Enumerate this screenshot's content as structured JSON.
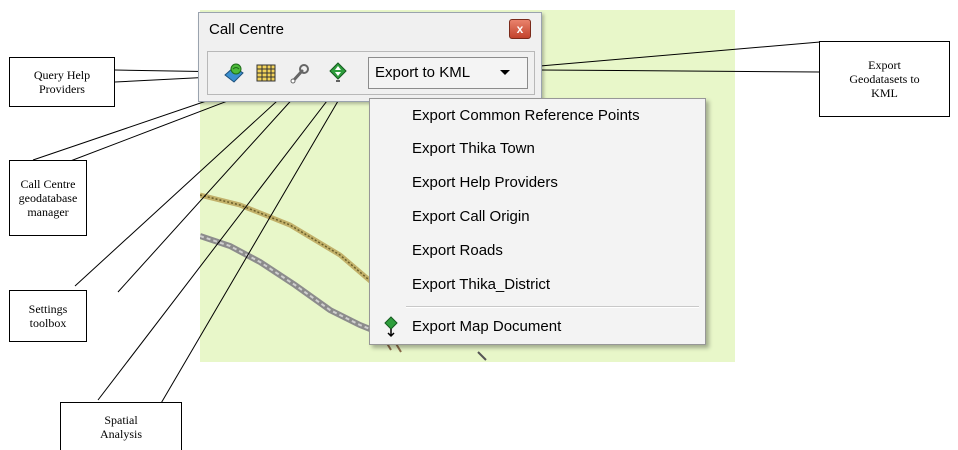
{
  "window": {
    "title": "Call Centre",
    "close_label": "x"
  },
  "toolbar": {
    "tools": [
      {
        "name": "query-help-providers-tool",
        "icon": "globe-query-icon"
      },
      {
        "name": "geodatabase-manager-tool",
        "icon": "grid-table-icon"
      },
      {
        "name": "settings-toolbox-tool",
        "icon": "wrench-icon"
      },
      {
        "name": "spatial-analysis-tool",
        "icon": "green-diamond-arrows-icon"
      }
    ],
    "export_label": "Export to KML"
  },
  "menu": {
    "items": [
      "Export Common Reference Points",
      "Export Thika Town",
      "Export Help Providers",
      "Export Call Origin",
      "Export Roads",
      "Export Thika_District"
    ],
    "map_document_label": "Export Map Document"
  },
  "callouts": {
    "query": "Query Help\nProviders",
    "geodatabase": "Call Centre\ngeodatabase\nmanager",
    "settings": "Settings\ntoolbox",
    "spatial": "Spatial\nAnalysis",
    "export": "Export\nGeodatasets to\nKML"
  },
  "colors": {
    "map_background": "#e8f7c9",
    "menu_background": "#f3f3f3",
    "toolbar_background": "#f0f0f0"
  }
}
